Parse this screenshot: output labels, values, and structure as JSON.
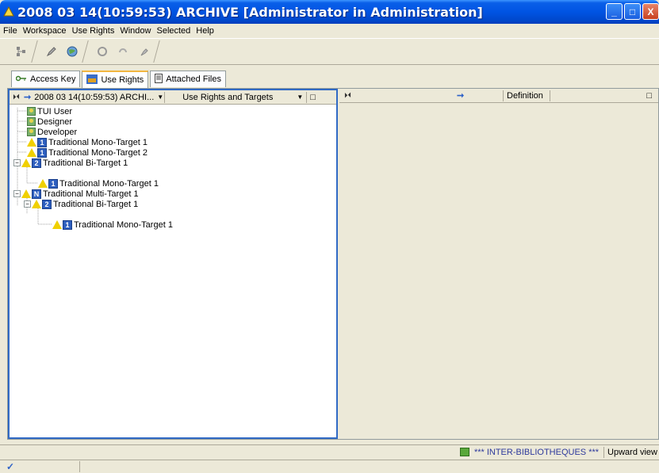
{
  "window": {
    "title": "2008 03 14(10:59:53) ARCHIVE [Administrator in Administration]",
    "minimize": "_",
    "maximize": "□",
    "close": "X"
  },
  "menu": [
    "File",
    "Workspace",
    "Use Rights",
    "Window",
    "Selected",
    "Help"
  ],
  "toolbar": {
    "icons": [
      "tree-icon",
      "pencil-icon",
      "globe-icon",
      "refresh-icon",
      "undo-icon",
      "pin-icon"
    ]
  },
  "tabs": [
    {
      "label": "Access Key",
      "icon": "key-icon"
    },
    {
      "label": "Use Rights",
      "icon": "use-rights-icon"
    },
    {
      "label": "Attached Files",
      "icon": "document-icon"
    }
  ],
  "left_panel": {
    "nav_glyph": "⏵⏴",
    "arrow": "➞",
    "source_combo": "2008 03 14(10:59:53) ARCHI...",
    "view_combo": "Use Rights and Targets",
    "maximize_glyph": "□",
    "tree": [
      {
        "label": "TUI User",
        "type": "user",
        "depth": 0
      },
      {
        "label": "Designer",
        "type": "user",
        "depth": 0
      },
      {
        "label": "Developer",
        "type": "user",
        "depth": 0
      },
      {
        "label": "Traditional Mono-Target 1",
        "type": "target",
        "badge": "1",
        "depth": 0
      },
      {
        "label": "Traditional Mono-Target 2",
        "type": "target",
        "badge": "1",
        "depth": 0
      },
      {
        "label": "Traditional Bi-Target 1",
        "type": "target",
        "badge": "2",
        "depth": 0,
        "expanded": true
      },
      {
        "label": "Traditional Mono-Target 1",
        "type": "target",
        "badge": "1",
        "depth": 1
      },
      {
        "label": "Traditional Multi-Target 1",
        "type": "target",
        "badge": "N",
        "depth": 0,
        "expanded": true
      },
      {
        "label": "Traditional Bi-Target 1",
        "type": "target",
        "badge": "2",
        "depth": 1,
        "expanded": true
      },
      {
        "label": "Traditional Mono-Target 1",
        "type": "target",
        "badge": "1",
        "depth": 2
      }
    ]
  },
  "right_panel": {
    "nav_glyph": "⏵⏴",
    "arrow": "➞",
    "column": "Definition",
    "maximize_glyph": "□"
  },
  "status": {
    "library": "*** INTER-BIBLIOTHEQUES ***",
    "view": "Upward view"
  },
  "bottom": {
    "check": "✓"
  },
  "colors": {
    "title_bar": "#0054e3",
    "selection_border": "#316ac5",
    "tab_accent": "#f2b640",
    "status_text": "#2e3a9c"
  }
}
